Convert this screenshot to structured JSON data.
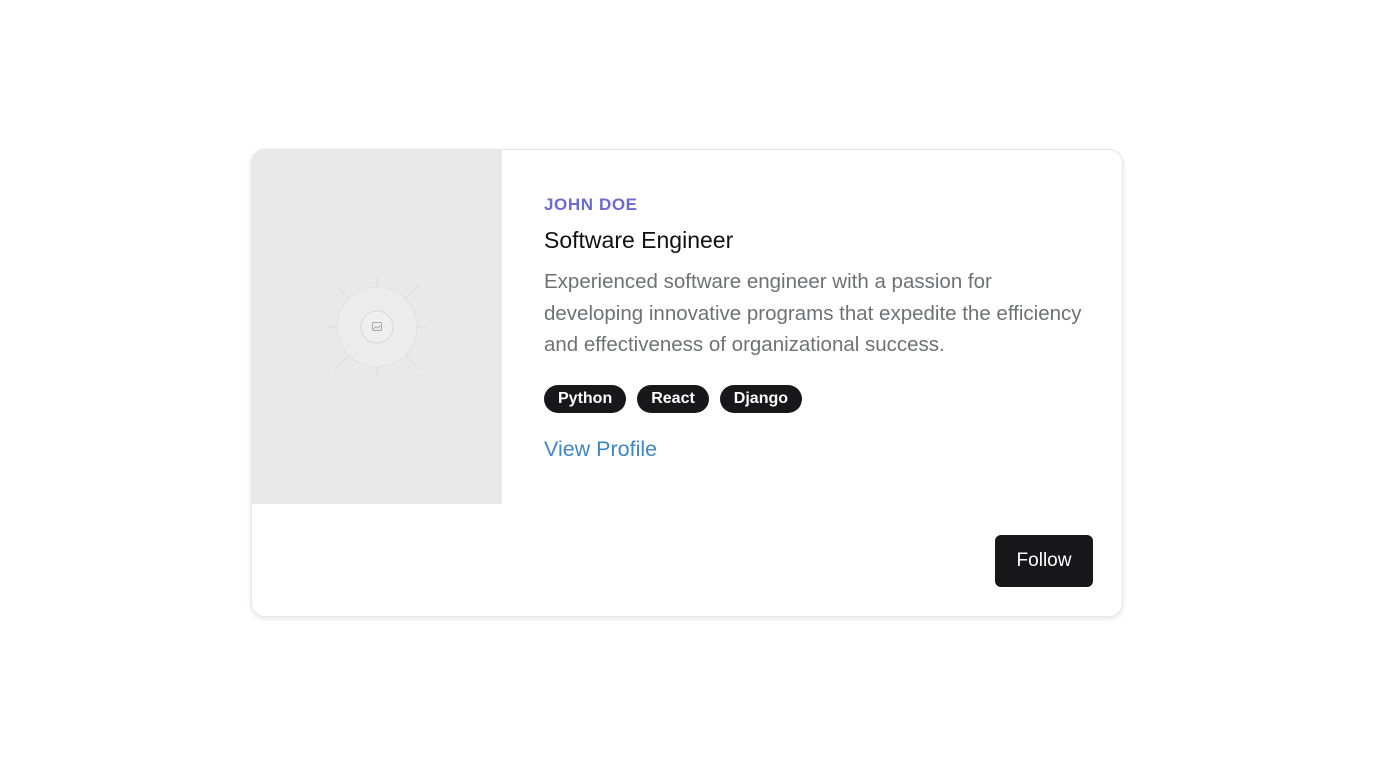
{
  "profile": {
    "name": "JOHN DOE",
    "title": "Software Engineer",
    "description": "Experienced software engineer with a passion for developing innovative programs that expedite the efficiency and effectiveness of organizational success.",
    "tags": [
      "Python",
      "React",
      "Django"
    ],
    "link_label": "View Profile"
  },
  "actions": {
    "follow_label": "Follow"
  },
  "media": {
    "icon": "image-placeholder-icon"
  },
  "colors": {
    "name_accent": "#6b6bd0",
    "link": "#3f86c8",
    "tag_bg": "#18181b",
    "button_bg": "#18181b",
    "media_bg": "#e9e9e9"
  }
}
